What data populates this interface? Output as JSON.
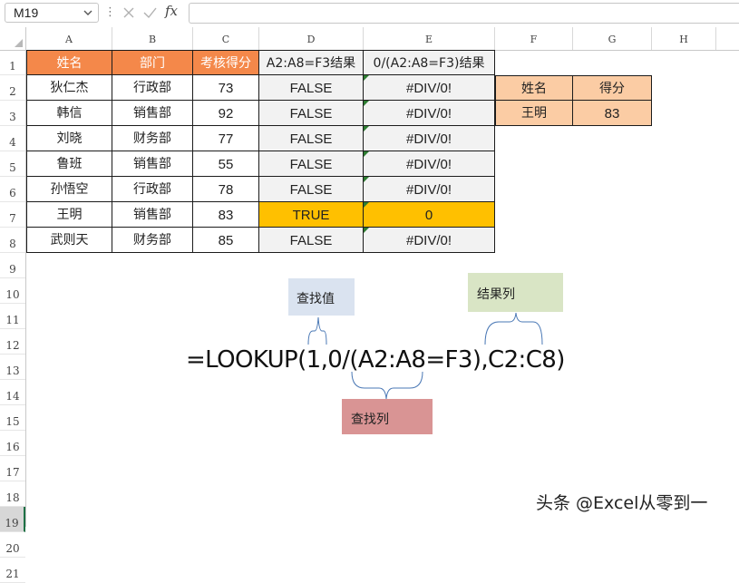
{
  "formula_bar": {
    "name_box": "M19",
    "fx_label": "fx",
    "formula": ""
  },
  "columns": [
    "A",
    "B",
    "C",
    "D",
    "E",
    "F",
    "G",
    "H"
  ],
  "rows": [
    "1",
    "2",
    "3",
    "4",
    "5",
    "6",
    "7",
    "8",
    "9",
    "10",
    "11",
    "12",
    "13",
    "14",
    "15",
    "16",
    "17",
    "18",
    "19",
    "20",
    "21"
  ],
  "selected_row": "19",
  "table": {
    "headers": [
      "姓名",
      "部门",
      "考核得分",
      "A2:A8=F3结果",
      "0/(A2:A8=F3)结果"
    ],
    "rows": [
      [
        "狄仁杰",
        "行政部",
        "73",
        "FALSE",
        "#DIV/0!"
      ],
      [
        "韩信",
        "销售部",
        "92",
        "FALSE",
        "#DIV/0!"
      ],
      [
        "刘晓",
        "财务部",
        "77",
        "FALSE",
        "#DIV/0!"
      ],
      [
        "鲁班",
        "销售部",
        "55",
        "FALSE",
        "#DIV/0!"
      ],
      [
        "孙悟空",
        "行政部",
        "78",
        "FALSE",
        "#DIV/0!"
      ],
      [
        "王明",
        "销售部",
        "83",
        "TRUE",
        "0"
      ],
      [
        "武则天",
        "财务部",
        "85",
        "FALSE",
        "#DIV/0!"
      ]
    ]
  },
  "lookup_table": {
    "headers": [
      "姓名",
      "得分"
    ],
    "values": [
      "王明",
      "83"
    ]
  },
  "annotations": {
    "lookup_value": "查找值",
    "result_column": "结果列",
    "lookup_column": "查找列",
    "formula": "=LOOKUP(1,0/(A2:A8=F3),C2:C8)"
  },
  "watermark": "头条 @Excel从零到一",
  "colors": {
    "header_orange": "#f4884a",
    "header_plain": "#f2f2f2",
    "body_fill": "#f2f2f2",
    "highlight": "#ffc000",
    "lookup_fill": "#fbcca4",
    "box_blue": "#dae3f0",
    "box_green": "#d9e5c5",
    "box_red": "#d99494",
    "brace_blue": "#4a78b5",
    "error_tick": "#2e7d32"
  }
}
